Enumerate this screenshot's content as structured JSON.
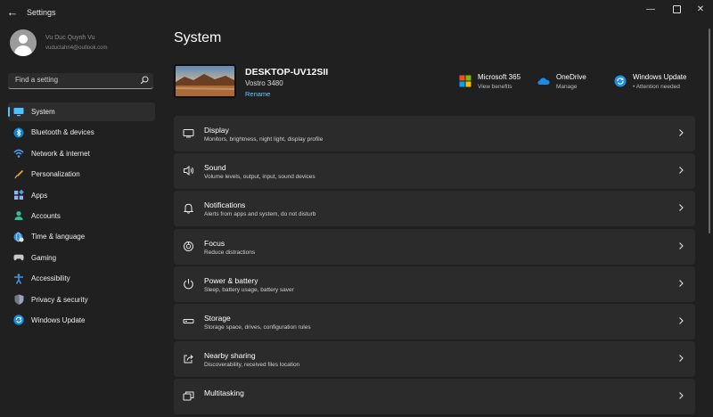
{
  "window": {
    "app_title": "Settings",
    "back_glyph": "←",
    "minimize_glyph": "—",
    "close_glyph": "✕"
  },
  "user": {
    "name": "Vu Duc Quynh Vu",
    "email": "vuductahn4@outlook.com"
  },
  "search": {
    "placeholder": "Find a setting"
  },
  "sidebar": {
    "items": [
      {
        "label": "System",
        "icon": "monitor-icon",
        "active": true
      },
      {
        "label": "Bluetooth & devices",
        "icon": "bluetooth-icon"
      },
      {
        "label": "Network & internet",
        "icon": "wifi-icon"
      },
      {
        "label": "Personalization",
        "icon": "brush-icon"
      },
      {
        "label": "Apps",
        "icon": "apps-icon"
      },
      {
        "label": "Accounts",
        "icon": "person-icon"
      },
      {
        "label": "Time & language",
        "icon": "globe-clock-icon"
      },
      {
        "label": "Gaming",
        "icon": "gamepad-icon"
      },
      {
        "label": "Accessibility",
        "icon": "accessibility-icon"
      },
      {
        "label": "Privacy & security",
        "icon": "shield-icon"
      },
      {
        "label": "Windows Update",
        "icon": "update-icon"
      }
    ]
  },
  "main": {
    "title": "System",
    "device": {
      "name": "DESKTOP-UV12SII",
      "model": "Vostro 3480",
      "rename_label": "Rename"
    },
    "quick_links": [
      {
        "title": "Microsoft 365",
        "subtitle": "View benefits",
        "icon": "microsoft-logo-icon"
      },
      {
        "title": "OneDrive",
        "subtitle": "Manage",
        "icon": "onedrive-cloud-icon"
      },
      {
        "title": "Windows Update",
        "subtitle": "• Attention needed",
        "icon": "update-icon"
      }
    ],
    "cards": [
      {
        "title": "Display",
        "subtitle": "Monitors, brightness, night light, display profile",
        "icon": "display-icon"
      },
      {
        "title": "Sound",
        "subtitle": "Volume levels, output, input, sound devices",
        "icon": "speaker-icon"
      },
      {
        "title": "Notifications",
        "subtitle": "Alerts from apps and system, do not disturb",
        "icon": "bell-icon"
      },
      {
        "title": "Focus",
        "subtitle": "Reduce distractions",
        "icon": "focus-icon"
      },
      {
        "title": "Power & battery",
        "subtitle": "Sleep, battery usage, battery saver",
        "icon": "power-icon"
      },
      {
        "title": "Storage",
        "subtitle": "Storage space, drives, configuration rules",
        "icon": "storage-icon"
      },
      {
        "title": "Nearby sharing",
        "subtitle": "Discoverability, received files location",
        "icon": "share-icon"
      },
      {
        "title": "Multitasking",
        "subtitle": "",
        "icon": "multitasking-icon"
      }
    ]
  },
  "colors": {
    "background": "#202020",
    "card": "#2b2b2b",
    "accent": "#4cc2ff",
    "link": "#60cdff"
  }
}
